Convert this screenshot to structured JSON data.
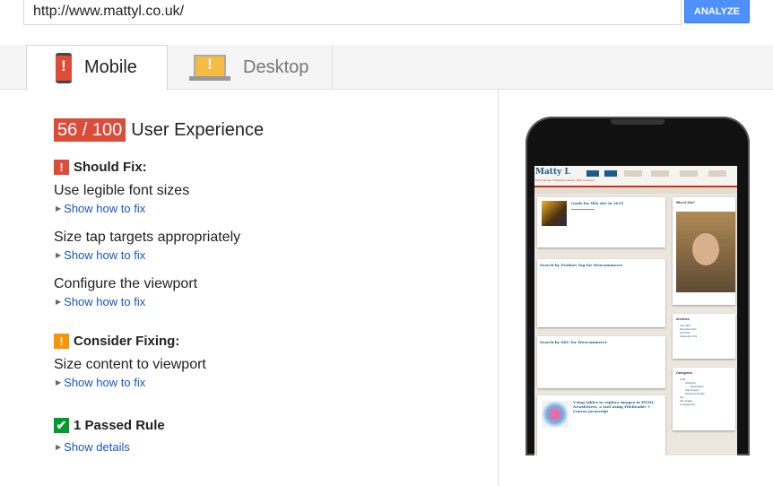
{
  "url_input": {
    "value": "http://www.mattyl.co.uk/"
  },
  "analyze_button": {
    "label": "ANALYZE"
  },
  "tabs": [
    {
      "label": "Mobile",
      "icon": "mobile-warning-icon",
      "active": true,
      "icon_color": "#dd4b39"
    },
    {
      "label": "Desktop",
      "icon": "desktop-warning-icon",
      "active": false,
      "icon_color": "#f6bb42"
    }
  ],
  "score": {
    "value": "56 / 100",
    "label": "User Experience",
    "color": "#dd4b39"
  },
  "sections": {
    "should_fix": {
      "title": "Should Fix:",
      "icon_glyph": "!",
      "rules": [
        {
          "title": "Use legible font sizes",
          "link": "Show how to fix"
        },
        {
          "title": "Size tap targets appropriately",
          "link": "Show how to fix"
        },
        {
          "title": "Configure the viewport",
          "link": "Show how to fix"
        }
      ]
    },
    "consider_fixing": {
      "title": "Consider Fixing:",
      "icon_glyph": "!",
      "rules": [
        {
          "title": "Size content to viewport",
          "link": "Show how to fix"
        }
      ]
    },
    "passed": {
      "title": "1 Passed Rule",
      "icon_glyph": "✔",
      "link": "Show details"
    }
  },
  "preview": {
    "site_title": "Matty L",
    "site_subtitle": "Personal site of Matthew Lawson, Web developer",
    "posts": [
      {
        "title": "Goals for this site in 2014"
      },
      {
        "title": "Search by Product Tag for Woocommerce"
      },
      {
        "title": "Search by SKU for Woocommerce"
      },
      {
        "title": "Using tables to replace images in HTML Newsletters, a tool using FileReader + Canvas javascript"
      }
    ],
    "sidebar": {
      "who_title": "Who is this?",
      "archives_title": "Archives",
      "archives": [
        "June 2014",
        "December 2013",
        "April 2013",
        "September 2012"
      ],
      "categories_title": "Categories",
      "categories": [
        "Code",
        "Javascript",
        "Bookmarklet",
        "Side Projects",
        "Wordpress Plugins",
        "php",
        "Site updates",
        "Uncategorized"
      ]
    }
  }
}
